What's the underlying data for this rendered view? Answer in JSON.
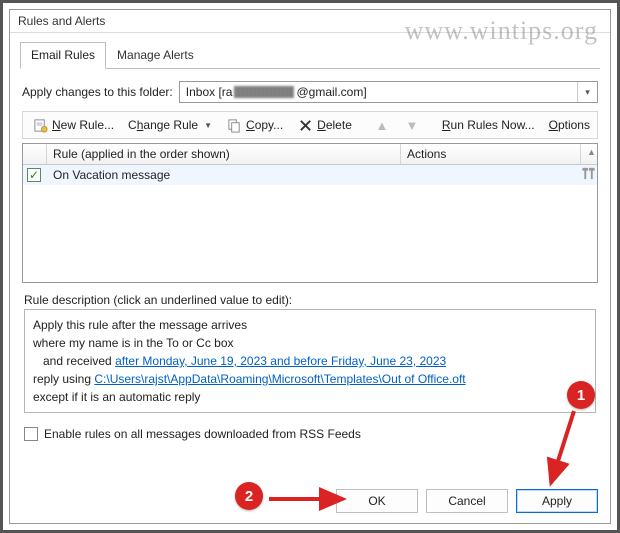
{
  "dialog_title": "Rules and Alerts",
  "watermark": "www.wintips.org",
  "tabs": {
    "email_rules": "Email Rules",
    "manage_alerts": "Manage Alerts"
  },
  "folder": {
    "label": "Apply changes to this folder:",
    "prefix": "Inbox [ra",
    "suffix": "@gmail.com]"
  },
  "toolbar": {
    "new_rule": "New Rule...",
    "change_rule": "Change Rule",
    "copy": "Copy...",
    "delete": "Delete",
    "run_now": "Run Rules Now...",
    "options": "Options"
  },
  "list": {
    "col_rule": "Rule (applied in the order shown)",
    "col_actions": "Actions",
    "rows": [
      {
        "checked": true,
        "name": "On Vacation message"
      }
    ]
  },
  "desc_label": "Rule description (click an underlined value to edit):",
  "desc": {
    "line1": "Apply this rule after the message arrives",
    "line2": "where my name is in the To or Cc box",
    "line3a": "   and received ",
    "date_range": "after Monday, June 19, 2023 and before Friday, June 23, 2023",
    "line4a": "reply using ",
    "template_path": "C:\\Users\\rajst\\AppData\\Roaming\\Microsoft\\Templates\\Out of Office.oft",
    "line5": "except if it is an automatic reply"
  },
  "rss_label": "Enable rules on all messages downloaded from RSS Feeds",
  "buttons": {
    "ok": "OK",
    "cancel": "Cancel",
    "apply": "Apply"
  },
  "annotations": {
    "badge1": "1",
    "badge2": "2"
  }
}
